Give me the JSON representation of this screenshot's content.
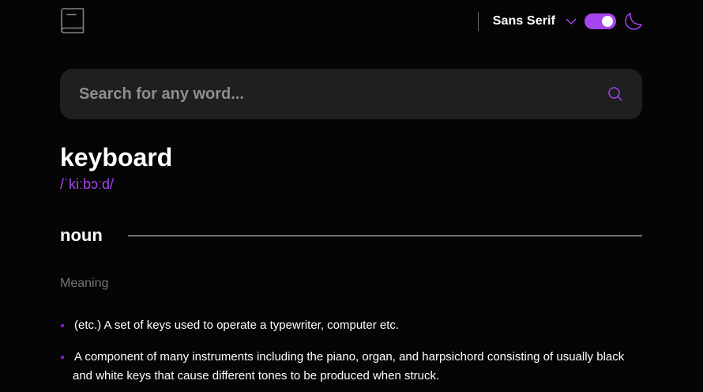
{
  "header": {
    "logo_icon": "book-icon",
    "font_label": "Sans Serif",
    "chevron_icon": "chevron-down-icon",
    "theme_toggle_on": true,
    "moon_icon": "moon-icon",
    "accent_color": "#a445ed"
  },
  "search": {
    "placeholder": "Search for any word...",
    "value": "",
    "icon": "search-icon"
  },
  "entry": {
    "word": "keyboard",
    "phonetic": "/ˈkiːbɔːd/",
    "part_of_speech": "noun",
    "meaning_label": "Meaning",
    "definitions": [
      " (etc.) A set of keys used to operate a typewriter, computer etc.",
      " A component of many instruments including the piano, organ, and harpsichord consisting of usually black and white keys that cause different tones to be produced when struck."
    ]
  }
}
